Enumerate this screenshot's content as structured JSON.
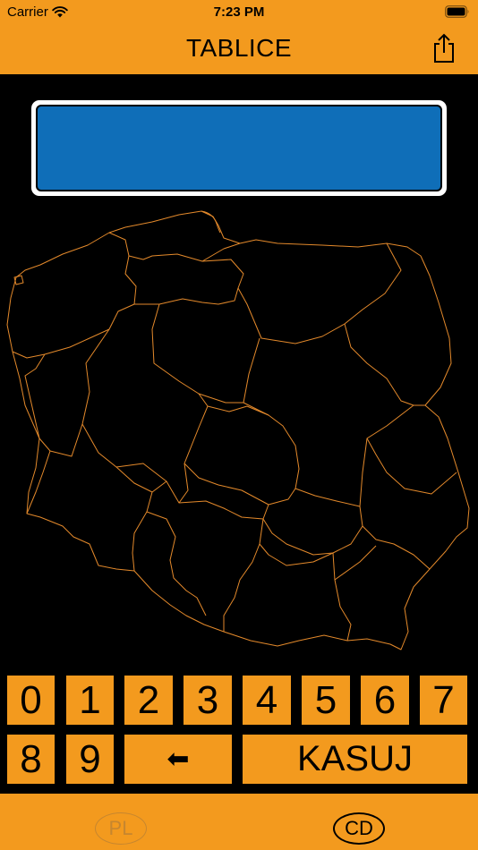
{
  "status": {
    "carrier": "Carrier",
    "time": "7:23 PM"
  },
  "nav": {
    "title": "TABLICE",
    "share_icon": "share-icon"
  },
  "plate": {
    "text": ""
  },
  "keypad": {
    "row1": [
      "0",
      "1",
      "2",
      "3",
      "4",
      "5",
      "6",
      "7"
    ],
    "row2": [
      "8",
      "9"
    ],
    "backspace": "⬅",
    "clear": "KASUJ"
  },
  "bottom": {
    "pl": "PL",
    "cd": "CD"
  },
  "colors": {
    "accent": "#F39A1E",
    "plate_blue": "#0F6EB8",
    "background": "#000000"
  }
}
